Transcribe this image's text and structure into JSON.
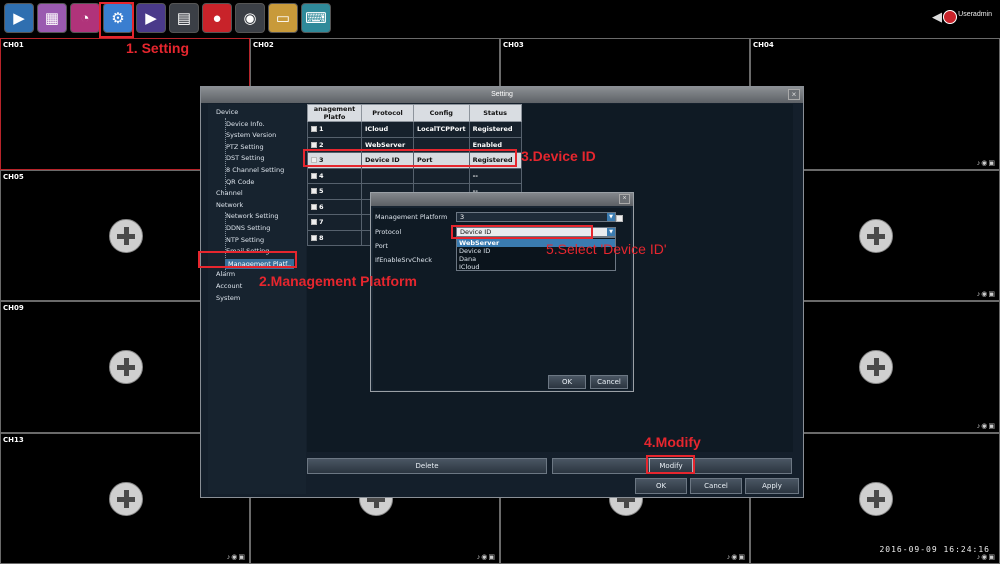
{
  "topbar": {
    "icons": [
      {
        "name": "live-view-icon",
        "glyph": "▶",
        "color": "#2f6fb0"
      },
      {
        "name": "image-icon",
        "glyph": "▦",
        "color": "#9a5ab0"
      },
      {
        "name": "alarm-icon",
        "glyph": "◔",
        "color": "#b0337a"
      },
      {
        "name": "setting-icon",
        "glyph": "⚙",
        "color": "#3a7ed0"
      },
      {
        "name": "playback-icon",
        "glyph": "▶",
        "color": "#4a3a8a"
      },
      {
        "name": "backup-icon",
        "glyph": "▤",
        "color": "#3b3f46"
      },
      {
        "name": "record-icon",
        "glyph": "●",
        "color": "#c8232a"
      },
      {
        "name": "camera-icon",
        "glyph": "◉",
        "color": "#3b3f46"
      },
      {
        "name": "folder-icon",
        "glyph": "▭",
        "color": "#c89a3a"
      },
      {
        "name": "keyboard-icon",
        "glyph": "⌨",
        "color": "#2f8a9a"
      }
    ],
    "user": "Useradmin",
    "speaker_glyph": "◀"
  },
  "grid": {
    "channels": [
      "CH01",
      "CH02",
      "CH03",
      "CH04",
      "CH05",
      "",
      "",
      "",
      "CH09",
      "",
      "",
      "",
      "CH13",
      "",
      "",
      ""
    ],
    "status_glyphs": "♪◉▣"
  },
  "annotations": {
    "setting": "1. Setting",
    "management_platform": "2.Management Platform",
    "device_id": "3.Device ID",
    "modify": "4.Modify",
    "select_device_id": "5.Select 'Device ID'"
  },
  "dialog": {
    "title": "Setting",
    "close": "×",
    "menu": [
      {
        "label": "Device",
        "level": 0
      },
      {
        "label": "Device Info.",
        "level": 1
      },
      {
        "label": "System Version",
        "level": 1
      },
      {
        "label": "PTZ Setting",
        "level": 1
      },
      {
        "label": "DST Setting",
        "level": 1
      },
      {
        "label": "8 Channel Setting",
        "level": 1
      },
      {
        "label": "QR Code",
        "level": 1
      },
      {
        "label": "Channel",
        "level": 0
      },
      {
        "label": "Network",
        "level": 0
      },
      {
        "label": "Network Setting",
        "level": 1
      },
      {
        "label": "DDNS Setting",
        "level": 1
      },
      {
        "label": "NTP Setting",
        "level": 1
      },
      {
        "label": "Email Setting",
        "level": 1
      },
      {
        "label": "Management Platf..",
        "level": 1,
        "selected": true
      },
      {
        "label": "Alarm",
        "level": 0
      },
      {
        "label": "Account",
        "level": 0
      },
      {
        "label": "System",
        "level": 0
      }
    ],
    "table": {
      "headers": [
        "anagement Platfo",
        "Protocol",
        "Config",
        "Status"
      ],
      "rows": [
        {
          "no": "1",
          "checked": true,
          "protocol": "ICloud",
          "config": "LocalTCPPort",
          "status": "Registered"
        },
        {
          "no": "2",
          "checked": true,
          "protocol": "WebServer",
          "config": "",
          "status": "Enabled"
        },
        {
          "no": "3",
          "checked": true,
          "protocol": "Device ID",
          "config": "Port",
          "status": "Registered",
          "selected": true
        },
        {
          "no": "4",
          "checked": false,
          "protocol": "",
          "config": "",
          "status": "--"
        },
        {
          "no": "5",
          "checked": false,
          "protocol": "",
          "config": "",
          "status": "--"
        },
        {
          "no": "6",
          "checked": false,
          "protocol": "",
          "config": "",
          "status": ""
        },
        {
          "no": "7",
          "checked": false,
          "protocol": "",
          "config": "",
          "status": ""
        },
        {
          "no": "8",
          "checked": false,
          "protocol": "",
          "config": "",
          "status": ""
        }
      ]
    },
    "buttons": {
      "delete": "Delete",
      "modify": "Modify",
      "ok": "OK",
      "cancel": "Cancel",
      "apply": "Apply"
    }
  },
  "subdialog": {
    "close": "×",
    "fields": {
      "management_platform_label": "Management Platform",
      "management_platform_value": "3",
      "protocol_label": "Protocol",
      "protocol_value": "Device ID",
      "port_label": "Port",
      "enable_label": "IfEnableSrvCheck"
    },
    "dropdown_options": [
      "WebServer",
      "Device ID",
      "Dana",
      "ICloud"
    ],
    "buttons": {
      "ok": "OK",
      "cancel": "Cancel"
    }
  },
  "datetime": "2016-09-09 16:24:16"
}
